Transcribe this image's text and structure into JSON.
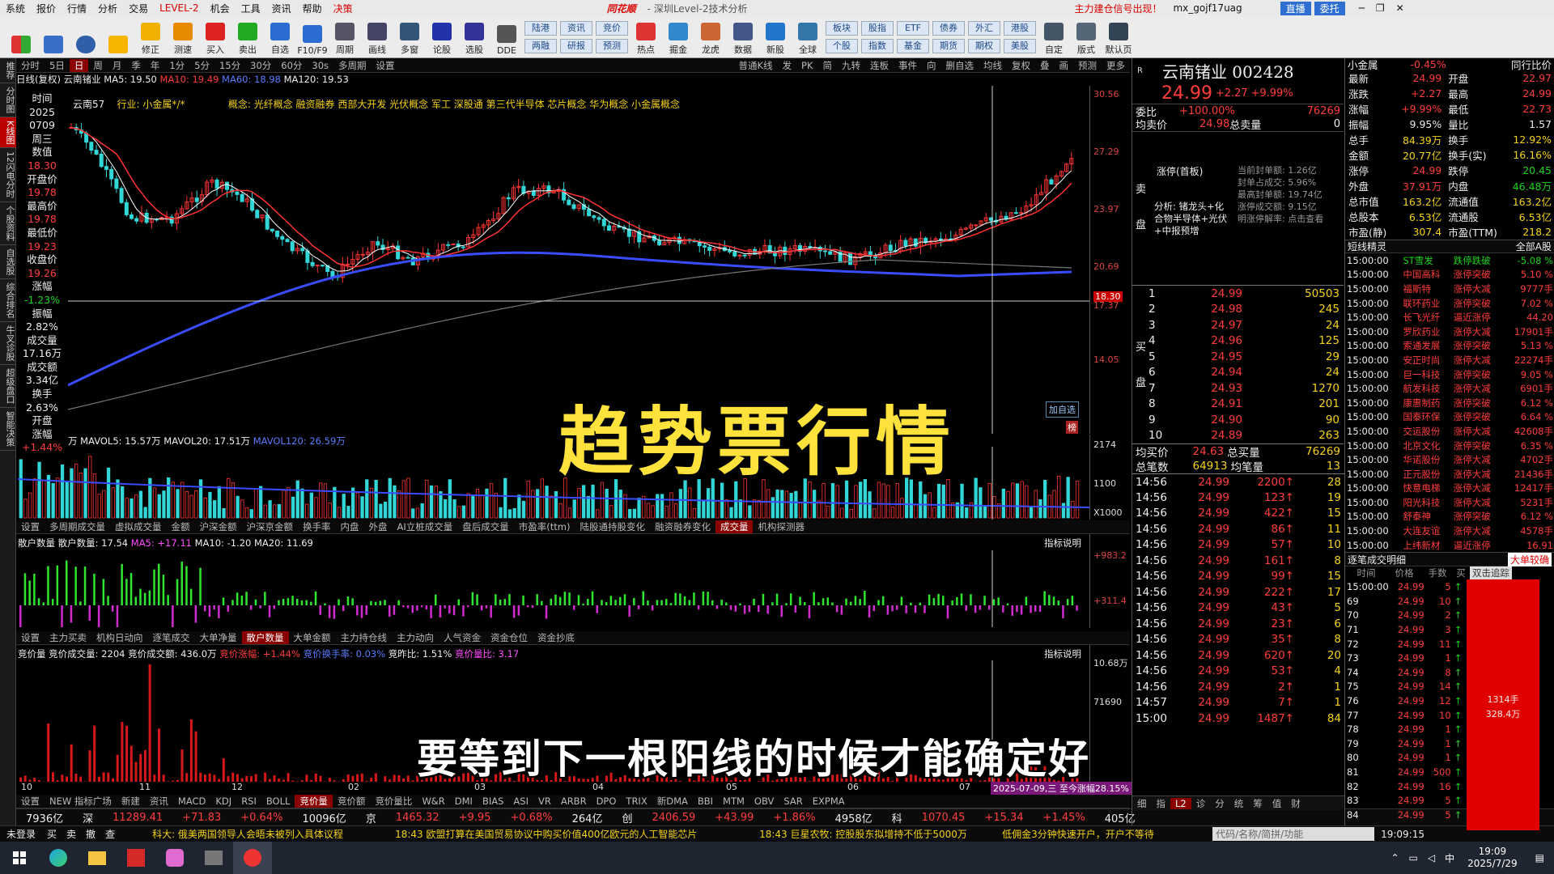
{
  "menu": {
    "items": [
      "系统",
      "报价",
      "行情",
      "分析",
      "交易",
      "LEVEL-2",
      "机会",
      "工具",
      "资讯",
      "帮助",
      "决策"
    ],
    "app_title": "同花顺",
    "window_title": "- 深圳Level-2技术分析",
    "alert": "主力建仓信号出现！",
    "user": "mx_gojf17uag",
    "btn_straight": "直播",
    "btn_delegate": "委托"
  },
  "toolbar": {
    "buttons": [
      "修正",
      "测速",
      "买入",
      "卖出",
      "自选",
      "F10/F9",
      "周期",
      "画线",
      "多窗",
      "论股",
      "选股",
      "DDE"
    ],
    "grid1": [
      "陆港",
      "两融"
    ],
    "grid2": [
      "资讯",
      "研报"
    ],
    "grid3": [
      "竞价",
      "预测"
    ],
    "buttons2": [
      "热点",
      "掘金",
      "龙虎",
      "数据",
      "新股",
      "全球"
    ],
    "grid4": [
      "板块",
      "个股"
    ],
    "grid5": [
      "股指",
      "指数"
    ],
    "grid6": [
      "ETF",
      "基金"
    ],
    "grid7": [
      "债券",
      "期货"
    ],
    "grid8": [
      "外汇",
      "期权"
    ],
    "grid9": [
      "港股",
      "美股"
    ],
    "buttons3": [
      "自定",
      "版式",
      "默认页"
    ]
  },
  "leftbar": [
    "推荐",
    "分时图",
    "K线图",
    "12闪电分时",
    "个股资料",
    "自选股",
    "综合排名",
    "牛叉诊股",
    "超级盘口",
    "智能决策"
  ],
  "period_tabs": [
    "分时",
    "5日",
    "日",
    "周",
    "月",
    "季",
    "年",
    "1分",
    "5分",
    "15分",
    "30分",
    "60分",
    "30s",
    "多周期",
    "设置"
  ],
  "chart_toolbar": [
    "普通K线",
    "发",
    "PK",
    "简",
    "九转",
    "连板",
    "事件",
    "向",
    "删自选",
    "均线",
    "复权",
    "叠",
    "画",
    "预测",
    "更多"
  ],
  "ma_line": {
    "name": "日线(复权)",
    "stock": "云南锗业",
    "ma5": "MA5: 19.50",
    "ma10": "MA10: 19.49",
    "ma60": "MA60: 18.98",
    "ma120": "MA120: 19.53"
  },
  "info_line": {
    "code": "云南57",
    "industry": "行业: 小金属*/*",
    "concepts": "概念: 光纤概念  融资融券  西部大开发  光伏概念  军工  深股通  第三代半导体  芯片概念  华为概念  小金属概念"
  },
  "side_info": [
    [
      "时间",
      "wht"
    ],
    [
      "2025",
      "wht"
    ],
    [
      "0709",
      "wht"
    ],
    [
      "周三",
      "wht"
    ],
    [
      "数值",
      "wht"
    ],
    [
      "18.30",
      "red"
    ],
    [
      "开盘价",
      "wht"
    ],
    [
      "19.78",
      "red"
    ],
    [
      "最高价",
      "wht"
    ],
    [
      "19.78",
      "red"
    ],
    [
      "最低价",
      "wht"
    ],
    [
      "19.23",
      "red"
    ],
    [
      "收盘价",
      "wht"
    ],
    [
      "19.26",
      "red"
    ],
    [
      "涨幅",
      "wht"
    ],
    [
      "-1.23%",
      "grn"
    ],
    [
      "振幅",
      "wht"
    ],
    [
      "2.82%",
      "wht"
    ],
    [
      "成交量",
      "wht"
    ],
    [
      "17.16万",
      "wht"
    ],
    [
      "成交额",
      "wht"
    ],
    [
      "3.34亿",
      "wht"
    ],
    [
      "换手",
      "wht"
    ],
    [
      "2.63%",
      "wht"
    ],
    [
      "开盘",
      "wht"
    ],
    [
      "涨幅",
      "wht"
    ],
    [
      "+1.44%",
      "red"
    ]
  ],
  "price_axis": [
    "30.56",
    "27.29",
    "23.97",
    "20.69",
    "18.30",
    "17.37",
    "14.05"
  ],
  "add_fav": "加自选",
  "alert_small": "榜",
  "vol_line": {
    "unit": "万",
    "mavol5": "MAVOL5: 15.57万",
    "mavol20": "MAVOL20: 17.51万",
    "mavol120": "MAVOL120: 26.59万"
  },
  "vol_axis": [
    "2174",
    "1100",
    "X1000"
  ],
  "ind_tabs1": [
    "设置",
    "多周期成交量",
    "虚拟成交量",
    "金额",
    "沪深金额",
    "沪深京金额",
    "换手率",
    "内盘",
    "外盘",
    "AI立桩成交量",
    "盘后成交量",
    "市盈率(ttm)",
    "陆股通持股变化",
    "融资融券变化",
    "成交量",
    "机构探测器"
  ],
  "retail_line": {
    "name": "散户数量",
    "val": "散户数量: 17.54",
    "ma5": "MA5: +17.11",
    "ma10": "MA10: -1.20",
    "ma20": "MA20: 11.69",
    "explain": "指标说明"
  },
  "retail_axis": [
    "+983.2",
    "+311.4"
  ],
  "ind_tabs2": [
    "设置",
    "主力买卖",
    "机构日动向",
    "逐笔成交",
    "大单净量",
    "散户数量",
    "大单金额",
    "主力持仓线",
    "主力动向",
    "人气资金",
    "资金仓位",
    "资金抄底"
  ],
  "auction_line": {
    "a": "竞价量",
    "b": "竞价成交量: 2204",
    "c": "竞价成交额: 436.0万",
    "d": "竞价涨幅: +1.44%",
    "e": "竞价换手率: 0.03%",
    "f": "竞昨比: 1.51%",
    "g": "竞价量比: 3.17",
    "explain": "指标说明"
  },
  "auction_axis": [
    "10.68万",
    "71690"
  ],
  "months": [
    "10",
    "11",
    "12",
    "02",
    "03",
    "04",
    "05",
    "06",
    "07"
  ],
  "date_marker": "2025-07-09,三 至今涨幅28.15%",
  "ind_tabs3": [
    "设置",
    "NEW 指标广场",
    "新建",
    "资讯",
    "MACD",
    "KDJ",
    "RSI",
    "BOLL",
    "竞价量",
    "竞价额",
    "竞价量比",
    "W&R",
    "DMI",
    "BIAS",
    "ASI",
    "VR",
    "ARBR",
    "DPO",
    "TRIX",
    "新DMA",
    "BBI",
    "MTM",
    "OBV",
    "SAR",
    "EXPMA"
  ],
  "index_bar": [
    [
      "7936亿",
      "wht"
    ],
    [
      "深",
      "wht"
    ],
    [
      "11289.41",
      "red"
    ],
    [
      "+71.83",
      "red"
    ],
    [
      "+0.64%",
      "red"
    ],
    [
      "10096亿",
      "wht"
    ],
    [
      "京",
      "wht"
    ],
    [
      "1465.32",
      "red"
    ],
    [
      "+9.95",
      "red"
    ],
    [
      "+0.68%",
      "red"
    ],
    [
      "264亿",
      "wht"
    ],
    [
      "创",
      "wht"
    ],
    [
      "2406.59",
      "red"
    ],
    [
      "+43.99",
      "red"
    ],
    [
      "+1.86%",
      "red"
    ],
    [
      "4958亿",
      "wht"
    ],
    [
      "科",
      "wht"
    ],
    [
      "1070.45",
      "red"
    ],
    [
      "+15.34",
      "red"
    ],
    [
      "+1.45%",
      "red"
    ],
    [
      "405亿",
      "wht"
    ]
  ],
  "news_bar": {
    "login": "未登录",
    "b1": "买",
    "b2": "卖",
    "b3": "撤",
    "b4": "查",
    "n1": "科大: 俄美两国领导人会晤未被列入具体议程",
    "n2": "18:43 欧盟打算在美国贸易协议中购买价值400亿欧元的人工智能芯片",
    "n3": "18:43 巨星农牧: 控股股东拟增持不低于5000万",
    "n4": "低佣金3分钟快速开户，开户不等待",
    "search": "代码/名称/简拼/功能",
    "time": "19:09:15"
  },
  "quote": {
    "title": "云南锗业 002428",
    "price": "24.99",
    "chg": "+2.27",
    "pct": "+9.99%",
    "wb_label": "委比",
    "wb": "+100.00%",
    "wc": "76269",
    "avg_label": "均卖价",
    "avg": "24.98",
    "total_sell_label": "总卖量",
    "total_sell": "0",
    "limit_title": "涨停(首板)",
    "lock1": "当前封单额: 1.26亿",
    "lock2": "封单占成交: 5.96%",
    "lock3": "最高封单额: 19.74亿",
    "lock4": "涨停成交额: 9.15亿",
    "lock5": "明涨停解率: 点击查看",
    "analysis": "分析: 锗龙头+化合物半导体+光伏+中报预增",
    "sell_label": "卖盘",
    "buy_label": "买盘"
  },
  "buy_book": [
    [
      "1",
      "24.99",
      "50503"
    ],
    [
      "2",
      "24.98",
      "245"
    ],
    [
      "3",
      "24.97",
      "24"
    ],
    [
      "4",
      "24.96",
      "125"
    ],
    [
      "5",
      "24.95",
      "29"
    ],
    [
      "6",
      "24.94",
      "24"
    ],
    [
      "7",
      "24.93",
      "1270"
    ],
    [
      "8",
      "24.91",
      "201"
    ],
    [
      "9",
      "24.90",
      "90"
    ],
    [
      "10",
      "24.89",
      "263"
    ]
  ],
  "buy_summary": {
    "avg_buy_label": "均买价",
    "avg_buy": "24.63",
    "total_buy_label": "总买量",
    "total_buy": "76269",
    "ticks_label": "总笔数",
    "ticks": "64913",
    "per_label": "均笔量",
    "per": "13"
  },
  "trades": [
    [
      "14:56",
      "24.99",
      "2200",
      "28"
    ],
    [
      "14:56",
      "24.99",
      "123",
      "19"
    ],
    [
      "14:56",
      "24.99",
      "422",
      "15"
    ],
    [
      "14:56",
      "24.99",
      "86",
      "11"
    ],
    [
      "14:56",
      "24.99",
      "57",
      "10"
    ],
    [
      "14:56",
      "24.99",
      "161",
      "8"
    ],
    [
      "14:56",
      "24.99",
      "99",
      "15"
    ],
    [
      "14:56",
      "24.99",
      "222",
      "17"
    ],
    [
      "14:56",
      "24.99",
      "43",
      "5"
    ],
    [
      "14:56",
      "24.99",
      "23",
      "6"
    ],
    [
      "14:56",
      "24.99",
      "35",
      "8"
    ],
    [
      "14:56",
      "24.99",
      "620",
      "20"
    ],
    [
      "14:56",
      "24.99",
      "53",
      "4"
    ],
    [
      "14:56",
      "24.99",
      "2",
      "1"
    ],
    [
      "14:57",
      "24.99",
      "7",
      "1"
    ],
    [
      "15:00",
      "24.99",
      "1487",
      "84"
    ]
  ],
  "bottom_tabs": [
    "细",
    "指",
    "L2",
    "诊",
    "分",
    "统",
    "筹",
    "值",
    "财"
  ],
  "stats_header": {
    "name": "小金属",
    "pct": "-0.45%",
    "label": "同行比价"
  },
  "stats": [
    [
      "最新",
      "24.99",
      "red",
      "开盘",
      "22.97",
      "red"
    ],
    [
      "涨跌",
      "+2.27",
      "red",
      "最高",
      "24.99",
      "red"
    ],
    [
      "涨幅",
      "+9.99%",
      "red",
      "最低",
      "22.73",
      "red"
    ],
    [
      "振幅",
      "9.95%",
      "wht",
      "量比",
      "1.57",
      "wht"
    ],
    [
      "总手",
      "84.39万",
      "yel",
      "换手",
      "12.92%",
      "yel"
    ],
    [
      "金额",
      "20.77亿",
      "yel",
      "换手(实)",
      "16.16%",
      "yel"
    ],
    [
      "涨停",
      "24.99",
      "red",
      "跌停",
      "20.45",
      "grn"
    ],
    [
      "外盘",
      "37.91万",
      "red",
      "内盘",
      "46.48万",
      "grn"
    ],
    [
      "总市值",
      "163.2亿",
      "yel",
      "流通值",
      "163.2亿",
      "yel"
    ],
    [
      "总股本",
      "6.53亿",
      "yel",
      "流通股",
      "6.53亿",
      "yel"
    ],
    [
      "市盈(静)",
      "307.4",
      "yel",
      "市盈(TTM)",
      "218.2",
      "yel"
    ]
  ],
  "sprite": {
    "title": "短线精灵",
    "filter": "全部A股"
  },
  "sprite_rows": [
    [
      "15:00:00",
      "ST雪发",
      "跌停跌破",
      "-5.08 %"
    ],
    [
      "15:00:00",
      "中国高科",
      "涨停突破",
      "5.10 %"
    ],
    [
      "15:00:00",
      "福斯特",
      "涨停大减",
      "9777手"
    ],
    [
      "15:00:00",
      "联环药业",
      "涨停突破",
      "7.02 %"
    ],
    [
      "15:00:00",
      "长飞光纤",
      "逼近涨停",
      "44.20"
    ],
    [
      "15:00:00",
      "罗欣药业",
      "涨停大减",
      "17901手"
    ],
    [
      "15:00:00",
      "索通发展",
      "涨停突破",
      "5.13 %"
    ],
    [
      "15:00:00",
      "安正时尚",
      "涨停大减",
      "22274手"
    ],
    [
      "15:00:00",
      "巨一科技",
      "涨停突破",
      "9.05 %"
    ],
    [
      "15:00:00",
      "航发科技",
      "涨停大减",
      "6901手"
    ],
    [
      "15:00:00",
      "康惠制药",
      "涨停突破",
      "6.12 %"
    ],
    [
      "15:00:00",
      "国泰环保",
      "涨停突破",
      "6.64 %"
    ],
    [
      "15:00:00",
      "交运股份",
      "涨停大减",
      "42608手"
    ],
    [
      "15:00:00",
      "北京文化",
      "涨停突破",
      "6.35 %"
    ],
    [
      "15:00:00",
      "华诺股份",
      "涨停大减",
      "4702手"
    ],
    [
      "15:00:00",
      "正元股份",
      "涨停大减",
      "21436手"
    ],
    [
      "15:00:00",
      "快意电梯",
      "涨停大减",
      "12417手"
    ],
    [
      "15:00:00",
      "阳光科技",
      "涨停大减",
      "5231手"
    ],
    [
      "15:00:00",
      "舒泰神",
      "涨停突破",
      "6.12 %"
    ],
    [
      "15:00:00",
      "大连友谊",
      "涨停大减",
      "4578手"
    ],
    [
      "15:00:00",
      "上纬新材",
      "逼近涨停",
      "16.91"
    ]
  ],
  "ticklist": {
    "title": "逐笔成交明细",
    "btn": "大单较确",
    "cols": [
      "时间",
      "价格",
      "手数",
      "买"
    ],
    "track": "双击追踪",
    "bigbar1": "1314手",
    "bigbar2": "328.4万"
  },
  "ticklist_rows": [
    [
      "15:00:00",
      "24.99",
      "5"
    ],
    [
      "69",
      "24.99",
      "10"
    ],
    [
      "70",
      "24.99",
      "2"
    ],
    [
      "71",
      "24.99",
      "3"
    ],
    [
      "72",
      "24.99",
      "11"
    ],
    [
      "73",
      "24.99",
      "1"
    ],
    [
      "74",
      "24.99",
      "8"
    ],
    [
      "75",
      "24.99",
      "14"
    ],
    [
      "76",
      "24.99",
      "12"
    ],
    [
      "77",
      "24.99",
      "10"
    ],
    [
      "78",
      "24.99",
      "1"
    ],
    [
      "79",
      "24.99",
      "1"
    ],
    [
      "80",
      "24.99",
      "1"
    ],
    [
      "81",
      "24.99",
      "500"
    ],
    [
      "82",
      "24.99",
      "16"
    ],
    [
      "83",
      "24.99",
      "5"
    ],
    [
      "84",
      "24.99",
      "5"
    ]
  ],
  "subtitles": {
    "big": "趋势票行情",
    "bottom": "要等到下一根阳线的时候才能确定好"
  },
  "taskbar": {
    "time": "19:09",
    "date": "2025/7/29",
    "ime": "中"
  }
}
